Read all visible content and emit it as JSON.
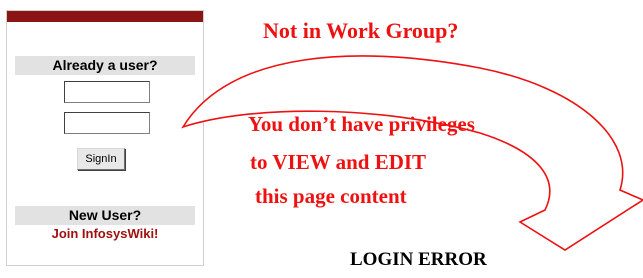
{
  "login_panel": {
    "existing_user_heading": "Already a user?",
    "username_value": "",
    "password_value": "",
    "signin_label": "SignIn",
    "new_user_heading": "New User?",
    "join_link_label": "Join InfosysWiki!"
  },
  "message": {
    "heading": "Not in Work Group?",
    "line1": "You don’t have privileges",
    "line2": "to VIEW and EDIT",
    "line3": "this page content"
  },
  "error_label": "LOGIN ERROR",
  "colors": {
    "panel_bar": "#8b1414",
    "message_text": "#ee1111",
    "arrow_outline": "#ee1111",
    "arrow_fill": "#ffffff",
    "join_link": "#a01010"
  },
  "icons": {
    "arrow": "curved-arrow-icon"
  }
}
